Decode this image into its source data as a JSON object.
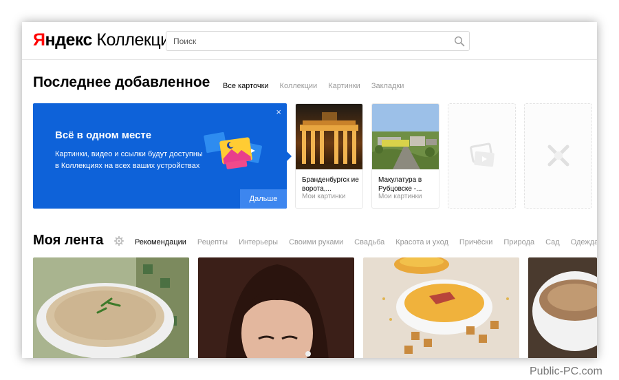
{
  "header": {
    "logo_brand": "Я",
    "logo_brand_rest": "ндекс",
    "logo_product": "Коллекции",
    "search_placeholder": "Поиск"
  },
  "recent": {
    "title": "Последнее добавленное",
    "tabs": [
      {
        "label": "Все карточки",
        "active": true
      },
      {
        "label": "Коллекции",
        "active": false
      },
      {
        "label": "Картинки",
        "active": false
      },
      {
        "label": "Закладки",
        "active": false
      }
    ],
    "promo": {
      "title": "Всё в одном месте",
      "text": "Картинки, видео и ссылки будут доступны в Коллекциях на всех ваших устройствах",
      "close": "×",
      "button": "Дальше"
    },
    "cards": [
      {
        "title": "Бранденбургск ие ворота,...",
        "subtitle": "Мои картинки"
      },
      {
        "title": "Макулатура в Рубцовске -...",
        "subtitle": "Мои картинки"
      }
    ]
  },
  "feed": {
    "title": "Моя лента",
    "tabs": [
      {
        "label": "Рекомендации",
        "active": true
      },
      {
        "label": "Рецепты",
        "active": false
      },
      {
        "label": "Интерьеры",
        "active": false
      },
      {
        "label": "Своими руками",
        "active": false
      },
      {
        "label": "Свадьба",
        "active": false
      },
      {
        "label": "Красота и уход",
        "active": false
      },
      {
        "label": "Причёски",
        "active": false
      },
      {
        "label": "Природа",
        "active": false
      },
      {
        "label": "Сад",
        "active": false
      },
      {
        "label": "Одежда и обувь",
        "active": false
      }
    ]
  },
  "colors": {
    "accent_blue": "#0e62d9",
    "button_blue": "#3d86ef",
    "brand_red": "#ff0000",
    "muted_text": "#999999"
  },
  "watermark": "Public-PC.com"
}
